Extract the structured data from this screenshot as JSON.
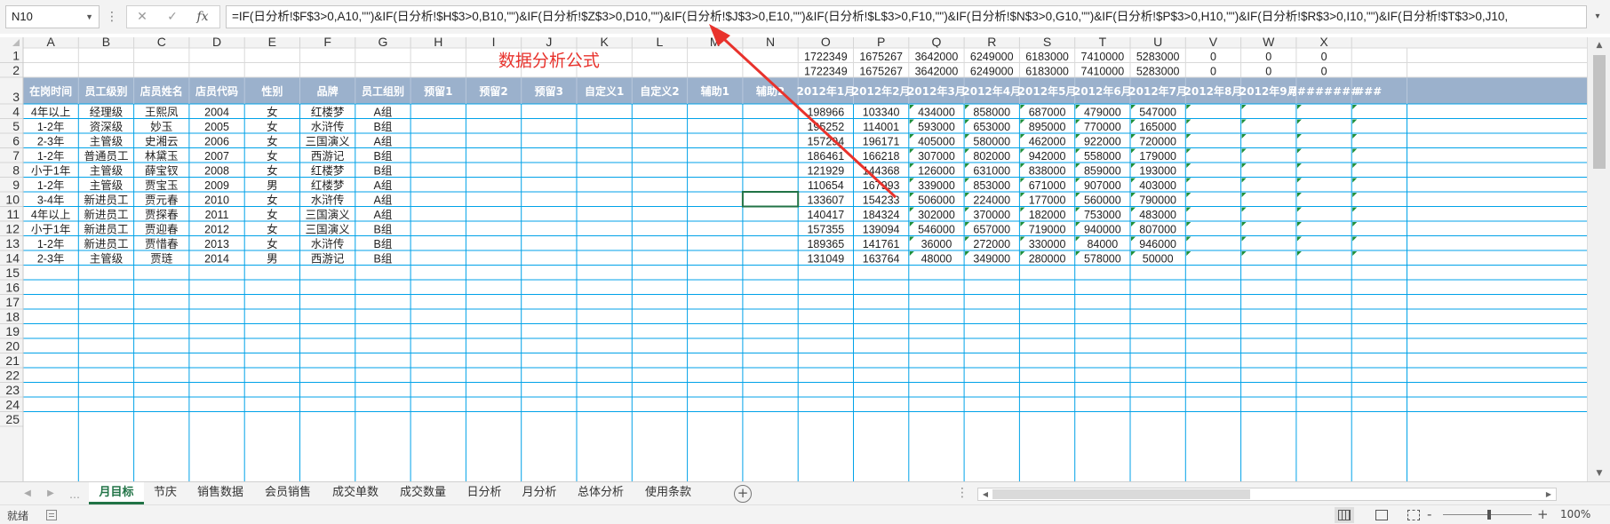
{
  "formula_bar": {
    "name_box": "N10",
    "cancel_glyph": "✕",
    "enter_glyph": "✓",
    "fx_label": "fx",
    "formula": "=IF(日分析!$F$3>0,A10,\"\")&IF(日分析!$H$3>0,B10,\"\")&IF(日分析!$Z$3>0,D10,\"\")&IF(日分析!$J$3>0,E10,\"\")&IF(日分析!$L$3>0,F10,\"\")&IF(日分析!$N$3>0,G10,\"\")&IF(日分析!$P$3>0,H10,\"\")&IF(日分析!$R$3>0,I10,\"\")&IF(日分析!$T$3>0,J10,"
  },
  "annotation": "数据分析公式",
  "columns": [
    "A",
    "B",
    "C",
    "D",
    "E",
    "F",
    "G",
    "H",
    "I",
    "J",
    "K",
    "L",
    "M",
    "N",
    "O",
    "P",
    "Q",
    "R",
    "S",
    "T",
    "U",
    "V",
    "W",
    "X"
  ],
  "header_row": [
    "在岗时间",
    "员工级别",
    "店员姓名",
    "店员代码",
    "性别",
    "品牌",
    "员工组别",
    "预留1",
    "预留2",
    "预留3",
    "自定义1",
    "自定义2",
    "辅助1",
    "辅助2",
    "2012年1月",
    "2012年2月",
    "2012年3月",
    "2012年4月",
    "2012年5月",
    "2012年6月",
    "2012年7月",
    "2012年8月",
    "2012年9月",
    "########",
    "###"
  ],
  "row1": [
    "1722349",
    "1675267",
    "3642000",
    "6249000",
    "6183000",
    "7410000",
    "5283000",
    "0",
    "0",
    "0"
  ],
  "row2": [
    "1722349",
    "1675267",
    "3642000",
    "6249000",
    "6183000",
    "7410000",
    "5283000",
    "0",
    "0",
    "0"
  ],
  "data_rows": [
    [
      "4年以上",
      "经理级",
      "王熙凤",
      "2004",
      "女",
      "红楼梦",
      "A组",
      "198966",
      "103340",
      "434000",
      "858000",
      "687000",
      "479000",
      "547000"
    ],
    [
      "1-2年",
      "资深级",
      "妙玉",
      "2005",
      "女",
      "水浒传",
      "B组",
      "195252",
      "114001",
      "593000",
      "653000",
      "895000",
      "770000",
      "165000"
    ],
    [
      "2-3年",
      "主管级",
      "史湘云",
      "2006",
      "女",
      "三国演义",
      "A组",
      "157294",
      "196171",
      "405000",
      "580000",
      "462000",
      "922000",
      "720000"
    ],
    [
      "1-2年",
      "普通员工",
      "林黛玉",
      "2007",
      "女",
      "西游记",
      "B组",
      "186461",
      "166218",
      "307000",
      "802000",
      "942000",
      "558000",
      "179000"
    ],
    [
      "小于1年",
      "主管级",
      "薛宝钗",
      "2008",
      "女",
      "红楼梦",
      "B组",
      "121929",
      "144368",
      "126000",
      "631000",
      "838000",
      "859000",
      "193000"
    ],
    [
      "1-2年",
      "主管级",
      "贾宝玉",
      "2009",
      "男",
      "红楼梦",
      "A组",
      "110654",
      "167993",
      "339000",
      "853000",
      "671000",
      "907000",
      "403000"
    ],
    [
      "3-4年",
      "新进员工",
      "贾元春",
      "2010",
      "女",
      "水浒传",
      "A组",
      "133607",
      "154233",
      "506000",
      "224000",
      "177000",
      "560000",
      "790000"
    ],
    [
      "4年以上",
      "新进员工",
      "贾探春",
      "2011",
      "女",
      "三国演义",
      "A组",
      "140417",
      "184324",
      "302000",
      "370000",
      "182000",
      "753000",
      "483000"
    ],
    [
      "小于1年",
      "新进员工",
      "贾迎春",
      "2012",
      "女",
      "三国演义",
      "B组",
      "157355",
      "139094",
      "546000",
      "657000",
      "719000",
      "940000",
      "807000"
    ],
    [
      "1-2年",
      "新进员工",
      "贾惜春",
      "2013",
      "女",
      "水浒传",
      "B组",
      "189365",
      "141761",
      "36000",
      "272000",
      "330000",
      "84000",
      "946000"
    ],
    [
      "2-3年",
      "主管级",
      "贾琏",
      "2014",
      "男",
      "西游记",
      "B组",
      "131049",
      "163764",
      "48000",
      "349000",
      "280000",
      "578000",
      "50000"
    ]
  ],
  "row_numbers": [
    "1",
    "2",
    "3",
    "4",
    "5",
    "6",
    "7",
    "8",
    "9",
    "10",
    "11",
    "12",
    "13",
    "14",
    "15",
    "16",
    "17",
    "18",
    "19",
    "20",
    "21",
    "22",
    "23",
    "24",
    "25"
  ],
  "sheet_tabs": [
    "月目标",
    "节庆",
    "销售数据",
    "会员销售",
    "成交单数",
    "成交数量",
    "日分析",
    "月分析",
    "总体分析",
    "使用条款"
  ],
  "active_tab": "月目标",
  "status": {
    "ready": "就绪",
    "zoom": "100%",
    "zoom_minus": "-",
    "zoom_plus": "+"
  },
  "icons": {
    "name_box_arrow": "chevron-down-icon",
    "cancel": "close-icon",
    "enter": "check-icon",
    "fx": "function-icon",
    "add_sheet": "plus-circle-icon",
    "view_normal": "grid-view-icon",
    "view_page_layout": "page-layout-icon",
    "view_page_break": "page-break-icon",
    "macro": "macro-record-icon"
  },
  "colors": {
    "header_band": "#9bb1cc",
    "grid_line": "#00a2e8",
    "annotation": "#e8322c",
    "active_tab": "#217346",
    "triangle": "#1d8f3a"
  }
}
